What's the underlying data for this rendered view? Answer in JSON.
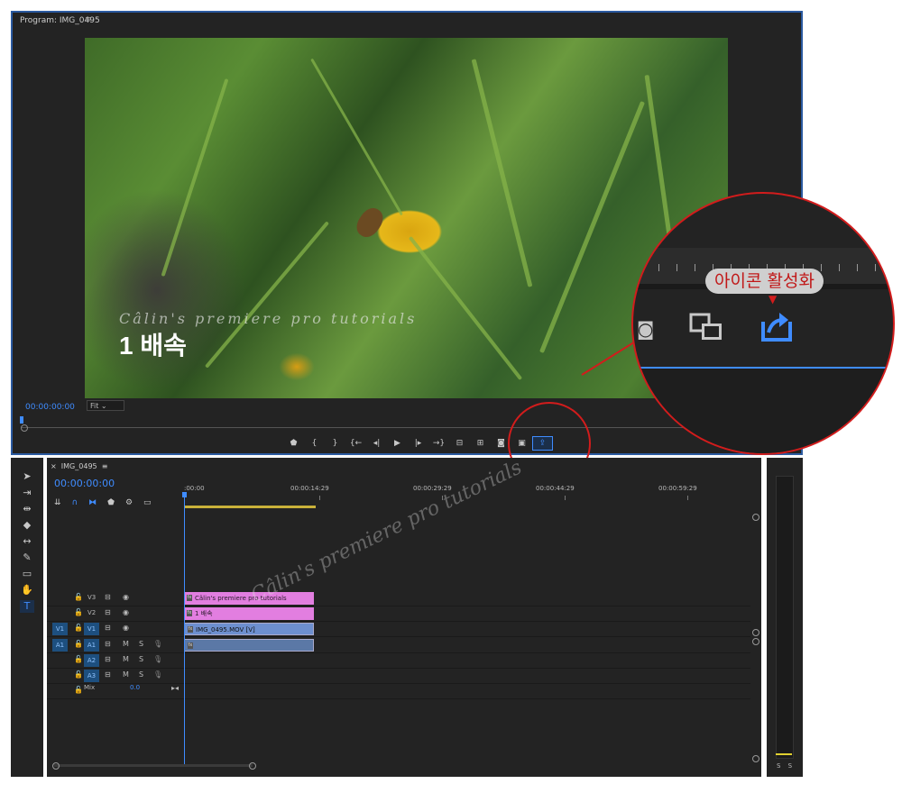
{
  "program_monitor": {
    "title": "Program: IMG_0495",
    "menu_icon": "hamburger-icon",
    "timecode": "00:00:00:00",
    "fit": "Fit",
    "overlay_script": "Câlin's premiere pro tutorials",
    "overlay_title": "1 배속",
    "transport_icons": [
      "marker-icon",
      "mark-in-icon",
      "mark-out-icon",
      "go-to-in-icon",
      "step-back-icon",
      "play-icon",
      "step-forward-icon",
      "go-to-out-icon",
      "insert-icon",
      "overwrite-icon",
      "export-frame-icon",
      "comparison-view-icon",
      "export-icon"
    ]
  },
  "callout": {
    "label": "아이콘 활성화",
    "icons": [
      "camera-icon",
      "comparison-view-icon",
      "export-icon"
    ],
    "accent": "#d21c1c"
  },
  "tools": [
    "selection-icon",
    "track-select-icon",
    "ripple-edit-icon",
    "razor-icon",
    "slip-icon",
    "pen-icon",
    "rectangle-icon",
    "hand-icon",
    "type-icon"
  ],
  "timeline": {
    "tab": "IMG_0495",
    "timecode": "00:00:00:00",
    "ruler": [
      ":00:00",
      "00:00:14:29",
      "00:00:29:29",
      "00:00:44:29",
      "00:00:59:29"
    ],
    "tracks": [
      {
        "name": "V3",
        "src": "",
        "clip": "Câlin's premiere pro tutorials",
        "kind": "pink"
      },
      {
        "name": "V2",
        "src": "",
        "clip": "1 배속",
        "kind": "pink"
      },
      {
        "name": "V1",
        "src": "V1",
        "clip": "IMG_0495.MOV [V]",
        "kind": "blue"
      },
      {
        "name": "A1",
        "src": "A1",
        "clip": "",
        "kind": "audio"
      },
      {
        "name": "A2",
        "src": "",
        "clip": "",
        "kind": ""
      },
      {
        "name": "A3",
        "src": "",
        "clip": "",
        "kind": ""
      }
    ],
    "mix_label": "Mix",
    "mix_value": "0.0",
    "watermark": "Câlin's premiere pro tutorials"
  },
  "meter": {
    "labels": "S S"
  },
  "colors": {
    "accent_blue": "#3f8cff",
    "panel": "#232323",
    "clip_pink": "#e27ee0",
    "clip_blue": "#6d8fcf"
  }
}
